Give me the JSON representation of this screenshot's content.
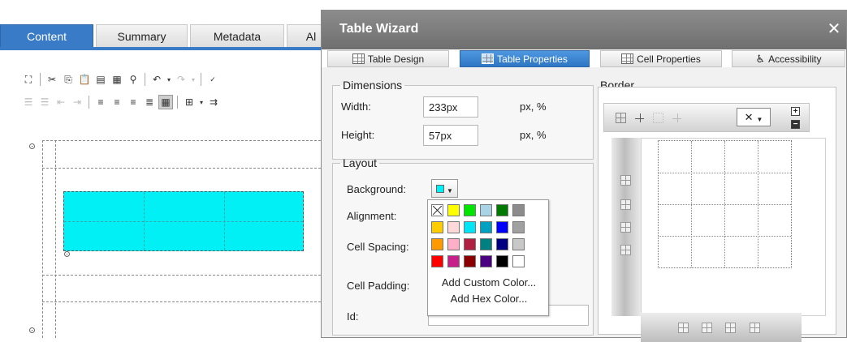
{
  "editor": {
    "tabs": [
      "Content",
      "Summary",
      "Metadata",
      "Al"
    ],
    "active_tab": "Content",
    "toolbar_row1": [
      "select-all-icon",
      "cut-icon",
      "copy-icon",
      "paste-icon",
      "paste-word-icon",
      "paste-text-icon",
      "find-icon",
      "undo-icon",
      "redo-icon",
      "spellcheck-icon"
    ],
    "toolbar_row2": [
      "numbered-list-icon",
      "bullet-list-icon",
      "outdent-icon",
      "indent-icon",
      "align-left-icon",
      "align-center-icon",
      "align-right-icon",
      "justify-icon",
      "table-properties-icon",
      "insert-table-icon",
      "more-icon"
    ],
    "table_color": "#00f0f6"
  },
  "dialog": {
    "title": "Table Wizard",
    "close_symbol": "✕",
    "tabs": [
      {
        "label": "Table Design"
      },
      {
        "label": "Table Properties"
      },
      {
        "label": "Cell Properties"
      },
      {
        "label": "Accessibility"
      }
    ],
    "active_tab": "Table Properties",
    "dimensions": {
      "legend": "Dimensions",
      "width_label": "Width:",
      "width_value": "233px",
      "width_units": "px, %",
      "height_label": "Height:",
      "height_value": "57px",
      "height_units": "px, %"
    },
    "layout": {
      "legend": "Layout",
      "background_label": "Background:",
      "background_color": "#00f0f6",
      "alignment_label": "Alignment:",
      "cell_spacing_label": "Cell Spacing:",
      "cell_padding_label": "Cell Padding:",
      "id_label": "Id:",
      "id_value": ""
    },
    "color_palette": {
      "colors": [
        "none",
        "#ffff00",
        "#00e600",
        "#a8d4e6",
        "#007a00",
        "#8c8c8c",
        "#ffcc00",
        "#ffd9d9",
        "#00e5f5",
        "#00a0c0",
        "#0000ff",
        "#a0a0a0",
        "#ff9900",
        "#ffb0c8",
        "#b02040",
        "#008080",
        "#000080",
        "#c8c8c8",
        "#ff0000",
        "#c8208a",
        "#8b0000",
        "#4b0082",
        "#000000",
        "#ffffff"
      ],
      "add_custom": "Add Custom Color...",
      "add_hex": "Add Hex Color..."
    },
    "border": {
      "legend": "Border",
      "style_value": "✕",
      "plus": "+",
      "minus": "−"
    }
  }
}
